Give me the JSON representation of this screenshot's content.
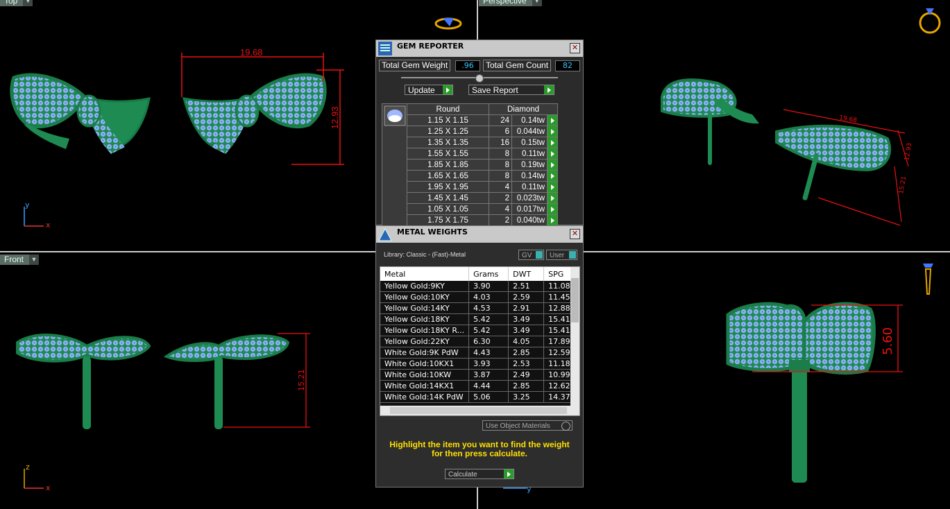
{
  "viewports": {
    "top_label": "Top",
    "perspective_label": "Perspective",
    "front_label": "Front",
    "axis_x": "x",
    "axis_y": "y",
    "axis_z": "z",
    "dims": {
      "top_width": "19.68",
      "top_height": "12.93",
      "front_height": "15.21",
      "persp_width": "19.68",
      "persp_a": "12.93",
      "persp_b": "15.21",
      "right_height": "5.60"
    }
  },
  "gem_reporter": {
    "title": "GEM REPORTER",
    "total_weight_label": "Total Gem Weight",
    "total_weight_value": ".96",
    "total_count_label": "Total Gem Count",
    "total_count_value": "82",
    "update_label": "Update",
    "save_report_label": "Save Report",
    "col_shape": "Round",
    "col_material": "Diamond",
    "rows": [
      {
        "size": "1.15 X 1.15",
        "count": "24",
        "tw": "0.14tw"
      },
      {
        "size": "1.25 X 1.25",
        "count": "6",
        "tw": "0.044tw"
      },
      {
        "size": "1.35 X 1.35",
        "count": "16",
        "tw": "0.15tw"
      },
      {
        "size": "1.55 X 1.55",
        "count": "8",
        "tw": "0.11tw"
      },
      {
        "size": "1.85 X 1.85",
        "count": "8",
        "tw": "0.19tw"
      },
      {
        "size": "1.65 X 1.65",
        "count": "8",
        "tw": "0.14tw"
      },
      {
        "size": "1.95 X 1.95",
        "count": "4",
        "tw": "0.11tw"
      },
      {
        "size": "1.45 X 1.45",
        "count": "2",
        "tw": "0.023tw"
      },
      {
        "size": "1.05 X 1.05",
        "count": "4",
        "tw": "0.017tw"
      },
      {
        "size": "1.75 X 1.75",
        "count": "2",
        "tw": "0.040tw"
      }
    ]
  },
  "metal_weights": {
    "title": "METAL WEIGHTS",
    "library": "Library: Classic - (Fast)-Metal",
    "gv_label": "GV",
    "user_label": "User",
    "columns": [
      "Metal",
      "Grams",
      "DWT",
      "SPG"
    ],
    "rows": [
      [
        "Yellow Gold:9KY",
        "3.90",
        "2.51",
        "11.08"
      ],
      [
        "Yellow Gold:10KY",
        "4.03",
        "2.59",
        "11.45"
      ],
      [
        "Yellow Gold:14KY",
        "4.53",
        "2.91",
        "12.88"
      ],
      [
        "Yellow Gold:18KY",
        "5.42",
        "3.49",
        "15.41"
      ],
      [
        "Yellow Gold:18KY R...",
        "5.42",
        "3.49",
        "15.41"
      ],
      [
        "Yellow Gold:22KY",
        "6.30",
        "4.05",
        "17.89"
      ],
      [
        "White Gold:9K PdW",
        "4.43",
        "2.85",
        "12.59"
      ],
      [
        "White Gold:10KX1",
        "3.93",
        "2.53",
        "11.18"
      ],
      [
        "White Gold:10KW",
        "3.87",
        "2.49",
        "10.99"
      ],
      [
        "White Gold:14KX1",
        "4.44",
        "2.85",
        "12.62"
      ],
      [
        "White Gold:14K PdW",
        "5.06",
        "3.25",
        "14.37"
      ]
    ],
    "use_object_materials": "Use Object Materials",
    "hint_line1": "Highlight the item you want to find the weight",
    "hint_line2": "for then press calculate.",
    "calculate_label": "Calculate"
  }
}
